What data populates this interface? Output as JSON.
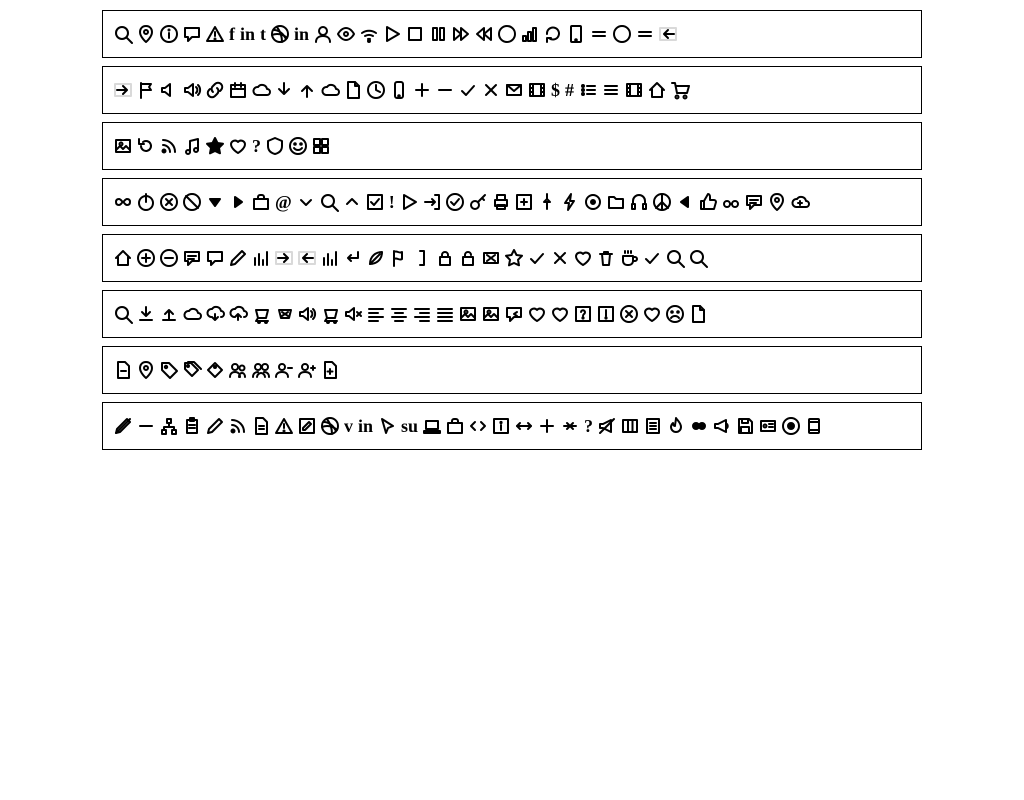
{
  "rows": [
    {
      "icons": [
        "search",
        "map-pin",
        "info-circle",
        "chat",
        "warning-triangle",
        "facebook-f",
        "linkedin-in",
        "tumblr-t",
        "dribbble",
        "linkedin-in",
        "user",
        "eye",
        "wifi",
        "play-triangle",
        "square",
        "pause",
        "fast-forward",
        "rewind",
        "circle",
        "signal-bars",
        "refresh",
        "tablet",
        "menu-short",
        "circle",
        "menu-short",
        "arrow-left-box"
      ]
    },
    {
      "icons": [
        "arrow-right-box",
        "flag",
        "volume-off",
        "volume-on",
        "link",
        "calendar",
        "cloud",
        "arrow-down-thick",
        "arrow-up-thick",
        "cloud",
        "document",
        "clock",
        "phone",
        "plus",
        "minus",
        "check",
        "x",
        "mail",
        "film",
        "dollar",
        "hash",
        "list-bullets",
        "list-lines",
        "film",
        "home",
        "cart"
      ]
    },
    {
      "icons": [
        "image",
        "redo",
        "rss",
        "music-note",
        "star-solid",
        "heart",
        "question",
        "shield",
        "smiley",
        "windows"
      ]
    },
    {
      "icons": [
        "infinity",
        "power",
        "x-circle",
        "ban",
        "caret-down-solid",
        "caret-right-solid",
        "briefcase",
        "at",
        "caret-down",
        "search",
        "caret-up",
        "checkbox",
        "exclaim",
        "play-triangle",
        "exit",
        "check-circle",
        "key",
        "printer",
        "plus-square",
        "pushpin",
        "bolt",
        "target",
        "folder",
        "headphones",
        "peace",
        "caret-left-solid",
        "thumbs-up",
        "glasses",
        "chat-lines",
        "map-pin",
        "cloud-plus"
      ]
    },
    {
      "icons": [
        "home",
        "plus-circle",
        "minus-circle",
        "chat-lines",
        "chat",
        "pencil",
        "bar-chart",
        "arrow-right-box",
        "arrow-left-box",
        "bar-chart",
        "enter",
        "leaf",
        "flag-outline",
        "bracket-right",
        "lock-closed",
        "lock-open",
        "mail-x",
        "star-outline",
        "check",
        "x-thin",
        "heart",
        "trash",
        "coffee",
        "check",
        "search",
        "search"
      ]
    },
    {
      "icons": [
        "search",
        "download",
        "upload",
        "cloud",
        "cloud-down",
        "cloud-up",
        "cart-handle",
        "cart-x",
        "volume-on",
        "cart-handle",
        "volume-mute",
        "align-left",
        "align-center",
        "align-right",
        "align-justify",
        "image",
        "image",
        "chat-reply",
        "heart-outline",
        "heart",
        "question-square",
        "exclaim-square",
        "x-circle",
        "heart",
        "sad-face",
        "document"
      ]
    },
    {
      "icons": [
        "document-minus",
        "map-pin",
        "tag",
        "tags",
        "tag-alt",
        "user-pair",
        "user-group",
        "user-minus",
        "user-plus",
        "document-plus"
      ]
    },
    {
      "icons": [
        "edit-slash",
        "minus",
        "sitemap",
        "clipboard",
        "pencil",
        "rss",
        "document-text",
        "warning-triangle",
        "edit-square",
        "dribbble",
        "vine-v",
        "linkedin-in",
        "cursor",
        "stumble",
        "laptop",
        "briefcase",
        "code",
        "info-square",
        "resize-h",
        "plus",
        "merge",
        "question",
        "megaphone-off",
        "columns",
        "list-doc",
        "fire",
        "record-dots",
        "megaphone",
        "save",
        "id-card",
        "disc",
        "device"
      ]
    }
  ],
  "glyphs": {
    "facebook-f": "f",
    "linkedin-in": "in",
    "tumblr-t": "t",
    "dollar": "$",
    "hash": "#",
    "at": "@",
    "exclaim": "!",
    "question": "?",
    "vine-v": "v",
    "stumble": "su"
  }
}
